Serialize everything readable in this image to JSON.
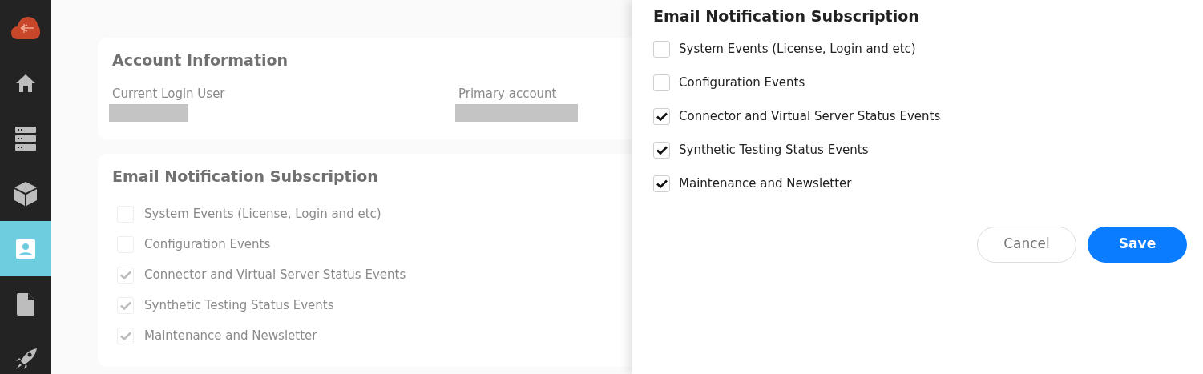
{
  "sidebar": {
    "items": [
      {
        "kind": "home",
        "selected": false
      },
      {
        "kind": "servers",
        "selected": false
      },
      {
        "kind": "cube",
        "selected": false
      },
      {
        "kind": "contact",
        "selected": true
      },
      {
        "kind": "file",
        "selected": false
      },
      {
        "kind": "rocket",
        "selected": false
      }
    ]
  },
  "account_card": {
    "title": "Account Information",
    "fields": [
      {
        "label": "Current Login User"
      },
      {
        "label": "Primary account"
      }
    ]
  },
  "subscription_card": {
    "title": "Email Notification Subscription",
    "options": [
      {
        "label": "System Events (License, Login and etc)",
        "checked": false
      },
      {
        "label": "Configuration Events",
        "checked": false
      },
      {
        "label": "Connector and Virtual Server Status Events",
        "checked": true
      },
      {
        "label": "Synthetic Testing Status Events",
        "checked": true
      },
      {
        "label": "Maintenance and Newsletter",
        "checked": true
      }
    ]
  },
  "drawer": {
    "title": "Email Notification Subscription",
    "options": [
      {
        "label": "System Events (License, Login and etc)",
        "checked": false
      },
      {
        "label": "Configuration Events",
        "checked": false
      },
      {
        "label": "Connector and Virtual Server Status Events",
        "checked": true
      },
      {
        "label": "Synthetic Testing Status Events",
        "checked": true
      },
      {
        "label": "Maintenance and Newsletter",
        "checked": true
      }
    ],
    "buttons": [
      {
        "label": "Cancel",
        "kind": "secondary"
      },
      {
        "label": "Save",
        "kind": "primary"
      }
    ]
  }
}
